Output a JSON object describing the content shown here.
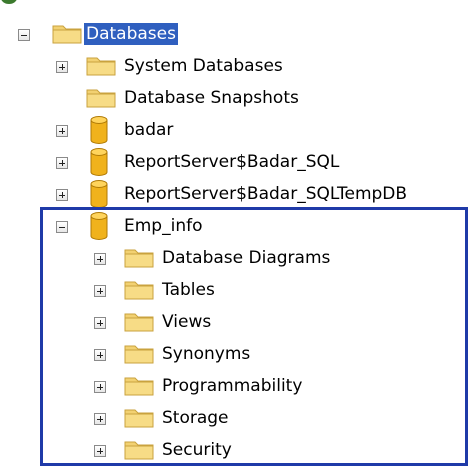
{
  "icons": {
    "folder": "folder-icon",
    "database": "database-icon",
    "expander_plus": "plus-expander-icon",
    "expander_minus": "minus-expander-icon"
  },
  "colors": {
    "selection": "#2f5fbf",
    "highlight_border": "#1f3aa8",
    "folder": "#f2d172",
    "database": "#e8a90f"
  },
  "tree": {
    "root": {
      "label": "Databases",
      "expanded": true,
      "selected": true
    },
    "databases": [
      {
        "label": "System Databases",
        "icon": "folder-icon",
        "expander": "plus"
      },
      {
        "label": "Database Snapshots",
        "icon": "folder-icon",
        "expander": "none"
      },
      {
        "label": "badar",
        "icon": "database-icon",
        "expander": "plus"
      },
      {
        "label": "ReportServer$Badar_SQL",
        "icon": "database-icon",
        "expander": "plus"
      },
      {
        "label": "ReportServer$Badar_SQLTempDB",
        "icon": "database-icon",
        "expander": "plus"
      },
      {
        "label": "Emp_info",
        "icon": "database-icon",
        "expander": "minus"
      }
    ],
    "emp_info_children": [
      {
        "label": "Database Diagrams"
      },
      {
        "label": "Tables"
      },
      {
        "label": "Views"
      },
      {
        "label": "Synonyms"
      },
      {
        "label": "Programmability"
      },
      {
        "label": "Storage"
      },
      {
        "label": "Security"
      }
    ]
  }
}
